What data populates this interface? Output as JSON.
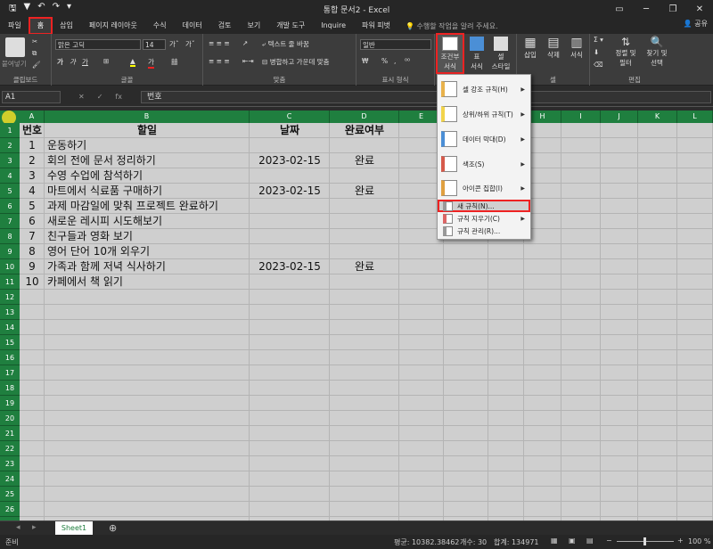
{
  "title": "통합 문서2 - Excel",
  "qat": [
    "save-icon",
    "filter-icon",
    "undo-icon",
    "redo-icon",
    "customize-icon"
  ],
  "window_controls": {
    "minimize": "─",
    "restore": "❐",
    "close": "✕"
  },
  "tabs": [
    "파일",
    "홈",
    "삽입",
    "페이지 레이아웃",
    "수식",
    "데이터",
    "검토",
    "보기",
    "개발 도구",
    "Inquire",
    "파워 피벗"
  ],
  "tell_me": "수행할 작업을 알려 주세요.",
  "share": "공유",
  "ribbon": {
    "clipboard": {
      "paste": "붙여넣기",
      "label": "클립보드"
    },
    "font": {
      "name": "맑은 고딕",
      "size": "14",
      "bold": "가",
      "italic": "가",
      "underline": "가",
      "color": "가",
      "label": "글꼴"
    },
    "alignment": {
      "wrap": "텍스트 줄 바꿈",
      "merge": "병합하고 가운데 맞춤",
      "label": "맞춤"
    },
    "number": {
      "format": "일반",
      "percent": "%",
      "comma": ",",
      "label": "표시 형식"
    },
    "styles": {
      "conditional_line1": "조건부",
      "conditional_line2": "서식",
      "table_line1": "표",
      "table_line2": "서식",
      "cell_line1": "셀",
      "cell_line2": "스타일"
    },
    "cells": {
      "insert": "삽입",
      "delete": "삭제",
      "format": "서식",
      "label": "셀"
    },
    "editing": {
      "sort_line1": "정렬 및",
      "sort_line2": "필터",
      "find_line1": "찾기 및",
      "find_line2": "선택",
      "label": "편집"
    }
  },
  "name_box": "A1",
  "formula_icons": [
    "✕",
    "✓",
    "fx"
  ],
  "formula_value": "번호",
  "columns": [
    "A",
    "B",
    "C",
    "D",
    "E",
    "F",
    "G",
    "H",
    "I",
    "J",
    "K",
    "L"
  ],
  "rows": [
    "1",
    "2",
    "3",
    "4",
    "5",
    "6",
    "7",
    "8",
    "9",
    "10",
    "11",
    "12",
    "13",
    "14",
    "15",
    "16",
    "17",
    "18",
    "19",
    "20",
    "21",
    "22",
    "23",
    "24",
    "25",
    "26",
    "27"
  ],
  "header_row": {
    "a": "번호",
    "b": "할일",
    "c": "날짜",
    "d": "완료여부"
  },
  "data_rows": [
    {
      "a": "1",
      "b": "운동하기",
      "c": "",
      "d": ""
    },
    {
      "a": "2",
      "b": "회의 전에 문서 정리하기",
      "c": "2023-02-15",
      "d": "완료"
    },
    {
      "a": "3",
      "b": "수영 수업에 참석하기",
      "c": "",
      "d": ""
    },
    {
      "a": "4",
      "b": "마트에서 식료품 구매하기",
      "c": "2023-02-15",
      "d": "완료"
    },
    {
      "a": "5",
      "b": "과제 마감일에 맞춰 프로젝트 완료하기",
      "c": "",
      "d": ""
    },
    {
      "a": "6",
      "b": "새로운 레시피 시도해보기",
      "c": "",
      "d": ""
    },
    {
      "a": "7",
      "b": "친구들과 영화 보기",
      "c": "",
      "d": ""
    },
    {
      "a": "8",
      "b": "영어 단어 10개 외우기",
      "c": "",
      "d": ""
    },
    {
      "a": "9",
      "b": "가족과 함께 저녁 식사하기",
      "c": "2023-02-15",
      "d": "완료"
    },
    {
      "a": "10",
      "b": "카페에서 책 읽기",
      "c": "",
      "d": ""
    }
  ],
  "menu": [
    {
      "label": "셀 강조 규칙(H)",
      "icon": "highlight-cells-icon",
      "submenu": true
    },
    {
      "label": "상위/하위 규칙(T)",
      "icon": "top-bottom-icon",
      "submenu": true
    },
    {
      "label": "데이터 막대(D)",
      "icon": "data-bars-icon",
      "submenu": true
    },
    {
      "label": "색조(S)",
      "icon": "color-scales-icon",
      "submenu": true
    },
    {
      "label": "아이콘 집합(I)",
      "icon": "icon-sets-icon",
      "submenu": true
    },
    {
      "label": "새 규칙(N)...",
      "icon": "new-rule-icon",
      "submenu": false
    },
    {
      "label": "규칙 지우기(C)",
      "icon": "clear-rules-icon",
      "submenu": true
    },
    {
      "label": "규칙 관리(R)...",
      "icon": "manage-rules-icon",
      "submenu": false
    }
  ],
  "sheet_tab": "Sheet1",
  "add_sheet": "⊕",
  "status": {
    "ready": "준비",
    "average": "평균: 10382.38462",
    "count": "개수: 30",
    "sum": "합계: 134971",
    "zoom": "100 %"
  },
  "colors": {
    "accent": "#1f7f3f",
    "highlight": "#e22222"
  }
}
